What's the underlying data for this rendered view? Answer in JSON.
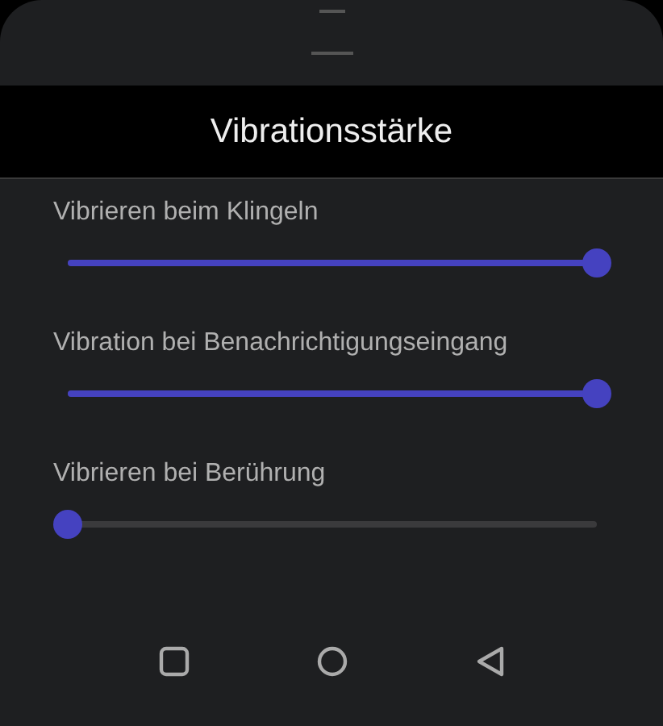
{
  "dialog": {
    "title": "Vibrationsstärke"
  },
  "sliders": [
    {
      "label": "Vibrieren beim Klingeln",
      "level": 1
    },
    {
      "label": "Vibration bei Benachrichtigungseingang",
      "level": 1
    },
    {
      "label": "Vibrieren bei Berührung",
      "level": 0
    }
  ]
}
